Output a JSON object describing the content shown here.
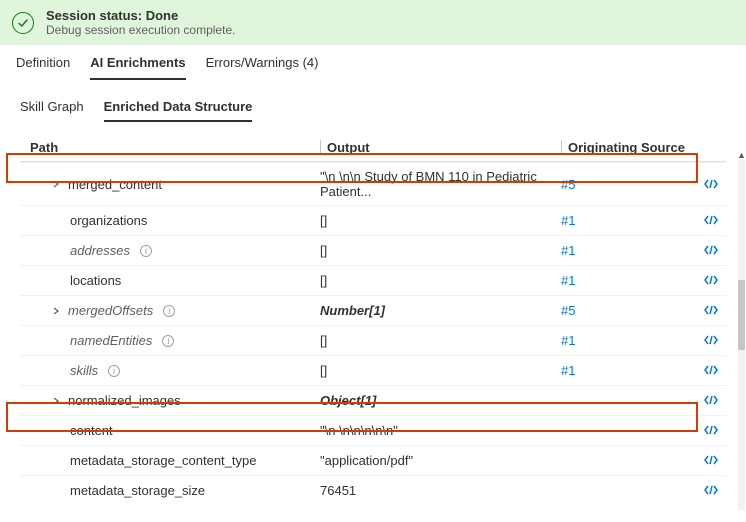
{
  "banner": {
    "title": "Session status: Done",
    "subtitle": "Debug session execution complete."
  },
  "tabs": {
    "definition": "Definition",
    "ai": "AI Enrichments",
    "errors": "Errors/Warnings (4)"
  },
  "subtabs": {
    "graph": "Skill Graph",
    "eds": "Enriched Data Structure"
  },
  "headers": {
    "path": "Path",
    "output": "Output",
    "src": "Originating Source"
  },
  "rows": {
    "merged_content": {
      "path": "merged_content",
      "output": "\"\\n \\n\\n Study of BMN 110 in Pediatric Patient...",
      "src": "#5"
    },
    "organizations": {
      "path": "organizations",
      "output": "[]",
      "src": "#1"
    },
    "addresses": {
      "path": "addresses",
      "output": "[]",
      "src": "#1"
    },
    "locations": {
      "path": "locations",
      "output": "[]",
      "src": "#1"
    },
    "mergedOffsets": {
      "path": "mergedOffsets",
      "output": "Number[1]",
      "src": "#5"
    },
    "namedEntities": {
      "path": "namedEntities",
      "output": "[]",
      "src": "#1"
    },
    "skills": {
      "path": "skills",
      "output": "[]",
      "src": "#1"
    },
    "normalized_images": {
      "path": "normalized_images",
      "output": "Object[1]"
    },
    "content": {
      "path": "content",
      "output": "\"\\n \\n\\n\\n\\n\\n\""
    },
    "mct": {
      "path": "metadata_storage_content_type",
      "output": "\"application/pdf\""
    },
    "mss": {
      "path": "metadata_storage_size",
      "output": "76451"
    }
  }
}
